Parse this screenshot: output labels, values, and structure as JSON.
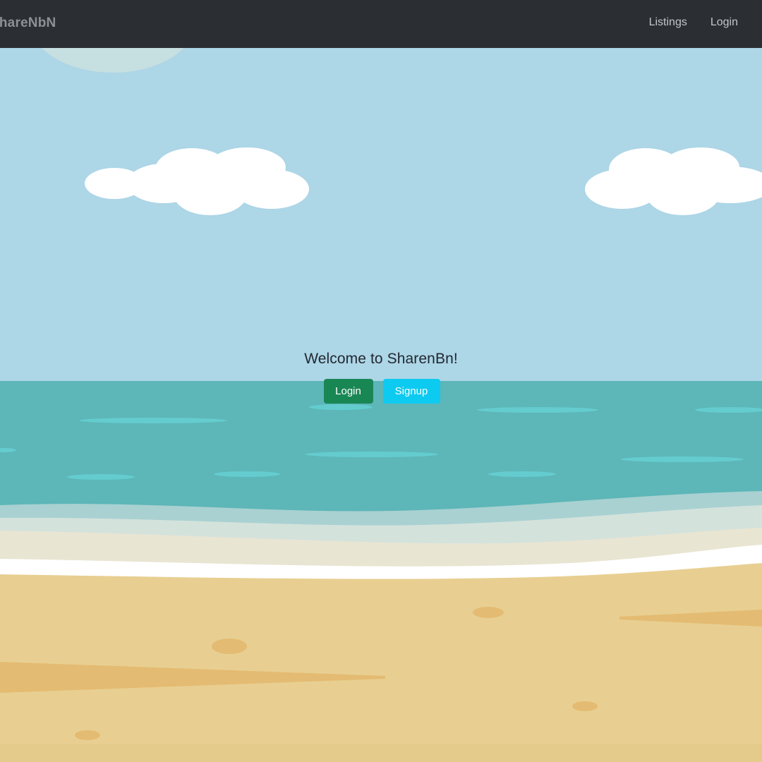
{
  "navbar": {
    "brand": "ShareNbN",
    "links": [
      {
        "label": "Listings",
        "icon": null
      },
      {
        "label": "Login",
        "icon": null
      }
    ],
    "background": "#2b2f33"
  },
  "hero": {
    "title": "Welcome to SharenBn!",
    "login_label": "Login",
    "signup_label": "Signup"
  },
  "colors": {
    "sky": "#add6e7",
    "sea": "#5db6b8",
    "sand": "#e8cf91",
    "login_button": "#198754",
    "signup_button": "#0dcaf0"
  },
  "background_illustration": "beach-scene"
}
